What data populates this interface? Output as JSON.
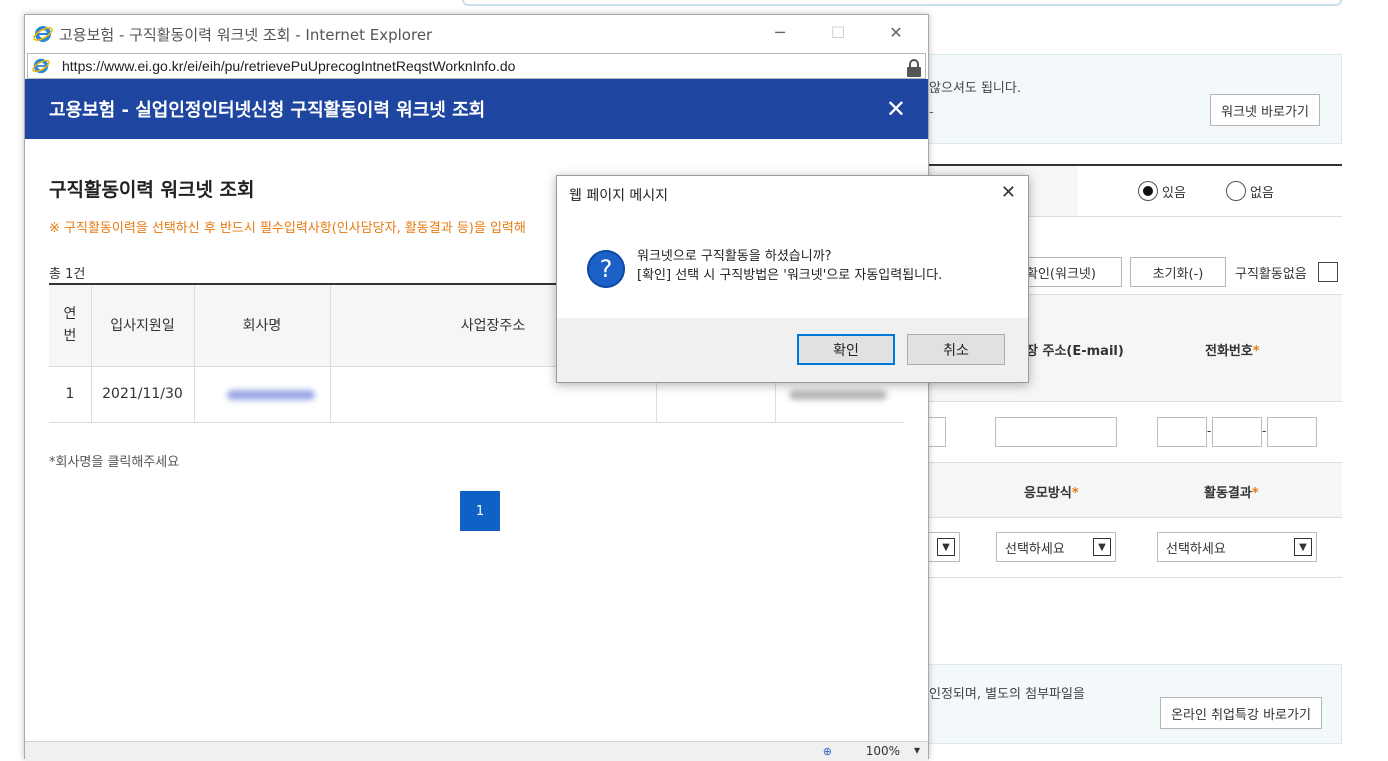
{
  "background": {
    "info1_text": "않으셔도 됩니다.",
    "info1_sub": "-",
    "worknet_link_label": "워크넷 바로가기",
    "radio_yes": "있음",
    "radio_no": "없음",
    "confirm_worknet_label": "확인(워크넷)",
    "reset_label": "초기화(-)",
    "no_activity_label": "구직활동없음",
    "col_email": "장 주소(E-mail)",
    "col_phone": "전화번호",
    "col_apply_method": "응모방식",
    "col_result": "활동결과",
    "select_placeholder": "선택하세요",
    "info2_text": "인정되며, 별도의 첨부파일을",
    "online_course_label": "온라인 취업특강 바로가기",
    "phone_dash": "-"
  },
  "ie_window": {
    "title": "고용보험 - 구직활동이력 워크넷 조회 - Internet Explorer",
    "url": "https://www.ei.go.kr/ei/eih/pu/retrievePuUprecogIntnetReqstWorknInfo.do",
    "minimize": "─",
    "maximize": "☐",
    "close": "✕",
    "zoom": "100%"
  },
  "popup": {
    "header_title": "고용보험 - 실업인정인터넷신청 구직활동이력 워크넷 조회",
    "close_symbol": "✕",
    "section_title": "구직활동이력 워크넷 조회",
    "notice": "※ 구직활동이력을 선택하신 후 반드시 필수입력사항(인사담당자, 활동결과 등)을 입력해",
    "total": "총 1건",
    "columns": [
      "연\n번",
      "입사지원일",
      "회사명",
      "사업장주소"
    ],
    "rows": [
      {
        "no": "1",
        "date": "2021/11/30"
      }
    ],
    "hint": "*회사명을 클릭해주세요",
    "page": "1"
  },
  "dialog": {
    "title": "웹 페이지 메시지",
    "close_symbol": "✕",
    "line1": "워크넷으로 구직활동을 하셨습니까?",
    "line2": "[확인] 선택 시 구직방법은 '워크넷'으로 자동입력됩니다.",
    "ok_label": "확인",
    "cancel_label": "취소"
  },
  "colors": {
    "header_blue": "#1e45a0",
    "accent_orange": "#e87a10",
    "page_blue": "#1061c6",
    "dialog_icon": "#1c60c8"
  }
}
